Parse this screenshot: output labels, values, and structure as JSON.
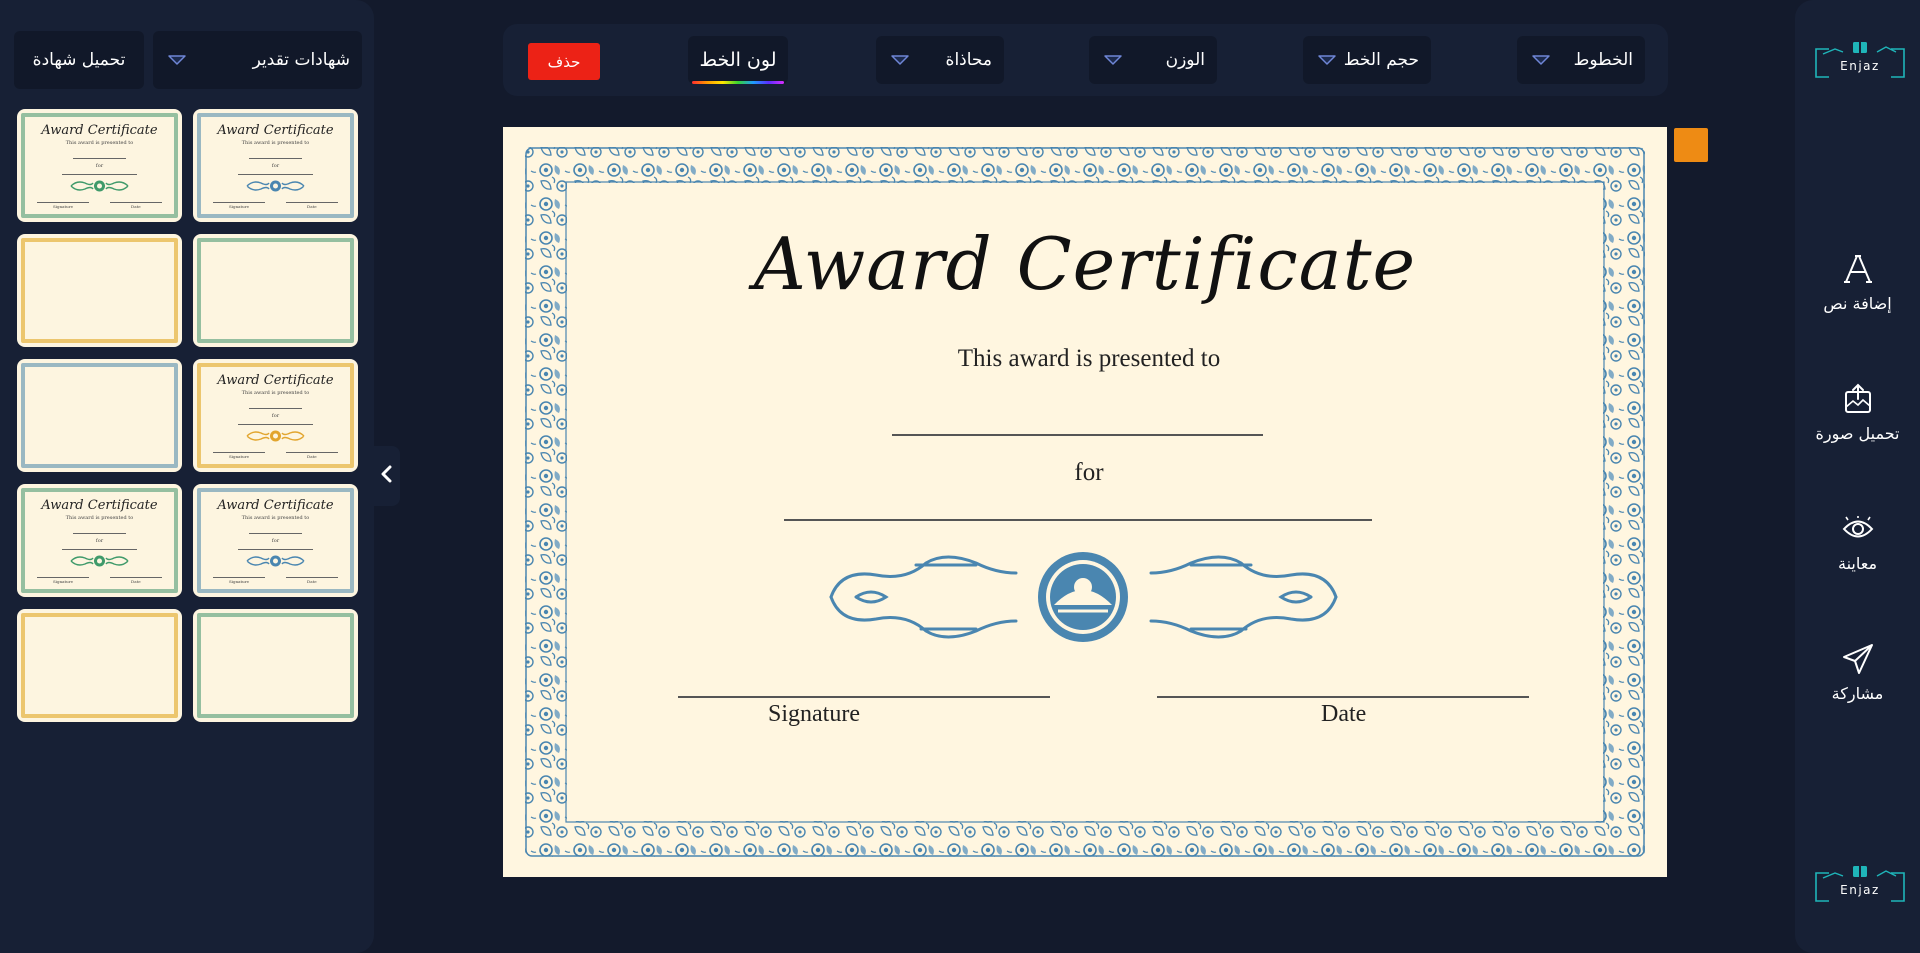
{
  "left_panel": {
    "upload_label": "تحميل شهادة",
    "category_label": "شهادات تقدير",
    "templates": [
      {
        "style": "green",
        "title": "Award Certificate",
        "subtitle": "This award is presented to",
        "for_text": "for",
        "signature": "Signature",
        "date": "Date"
      },
      {
        "style": "blue",
        "title": "Award Certificate",
        "subtitle": "This award is presented to",
        "for_text": "for",
        "signature": "Signature",
        "date": "Date"
      },
      {
        "style": "gold",
        "title": "",
        "subtitle": "",
        "for_text": "",
        "signature": "",
        "date": ""
      },
      {
        "style": "green",
        "title": "",
        "subtitle": "",
        "for_text": "",
        "signature": "",
        "date": ""
      },
      {
        "style": "blue",
        "title": "",
        "subtitle": "",
        "for_text": "",
        "signature": "",
        "date": ""
      },
      {
        "style": "gold",
        "title": "Award Certificate",
        "subtitle": "This award is presented to",
        "for_text": "for",
        "signature": "Signature",
        "date": "Date"
      },
      {
        "style": "green",
        "title": "Award Certificate",
        "subtitle": "This award is presented to",
        "for_text": "for",
        "signature": "Signature",
        "date": "Date"
      },
      {
        "style": "blue",
        "title": "Award Certificate",
        "subtitle": "This award is presented to",
        "for_text": "for",
        "signature": "Signature",
        "date": "Date"
      },
      {
        "style": "gold",
        "title": "",
        "subtitle": "",
        "for_text": "",
        "signature": "",
        "date": ""
      },
      {
        "style": "green",
        "title": "",
        "subtitle": "",
        "for_text": "",
        "signature": "",
        "date": ""
      }
    ]
  },
  "toolbar": {
    "fonts_label": "الخطوط",
    "font_size_label": "حجم الخط",
    "weight_label": "الوزن",
    "align_label": "محاذاة",
    "font_color_label": "لون الخط",
    "delete_label": "حذف"
  },
  "certificate": {
    "title": "Award Certificate",
    "presented": "This award is presented to",
    "for_text": "for",
    "signature": "Signature",
    "date": "Date"
  },
  "sidebar": {
    "logo_text": "Enjaz",
    "items": [
      {
        "label": "إضافة نص",
        "icon": "text-icon"
      },
      {
        "label": "تحميل صورة",
        "icon": "upload-image-icon"
      },
      {
        "label": "معاينة",
        "icon": "eye-icon"
      },
      {
        "label": "مشاركة",
        "icon": "send-icon"
      }
    ]
  },
  "colors": {
    "background": "#131a2c",
    "panel": "#172035",
    "control": "#111829",
    "delete": "#ec2216",
    "swatch": "#ee8b14",
    "paper": "#fff6e0",
    "border_blue": "#4a86b0",
    "logo_teal": "#1fb5b9"
  }
}
